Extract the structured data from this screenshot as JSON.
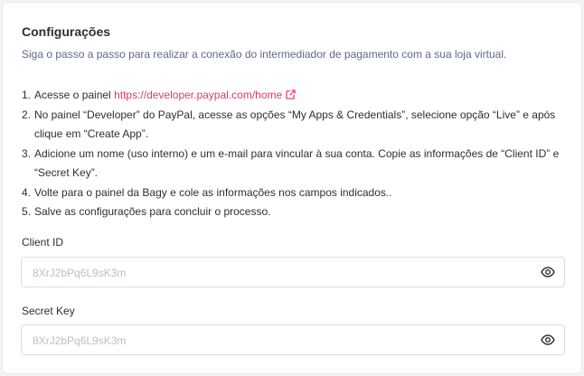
{
  "header": {
    "title": "Configurações",
    "subtitle": "Siga o passo a passo para realizar a conexão do intermediador de pagamento com a sua loja virtual."
  },
  "steps": [
    {
      "num": "1.",
      "text": "Acesse o painel ",
      "link": "https://developer.paypal.com/home"
    },
    {
      "num": "2.",
      "text": "No painel “Developer” do PayPal, acesse as opções “My Apps & Credentials”, selecione opção “Live” e após clique em “Create App”."
    },
    {
      "num": "3.",
      "text": "Adicione um nome (uso interno) e um e-mail para vincular à sua conta. Copie as informações de “Client ID” e “Secret Key”."
    },
    {
      "num": "4.",
      "text": "Volte para o painel da Bagy e cole as informações nos campos indicados.."
    },
    {
      "num": "5.",
      "text": "Salve as configurações para concluir o processo."
    }
  ],
  "fields": {
    "client_id": {
      "label": "Client ID",
      "placeholder": "8XrJ2bPq6L9sK3m",
      "value": ""
    },
    "secret_key": {
      "label": "Secret Key",
      "placeholder": "8XrJ2bPq6L9sK3m",
      "value": ""
    }
  },
  "icons": {
    "external_link": "external-link-icon",
    "eye": "eye-icon"
  },
  "colors": {
    "link": "#e8336b",
    "subtitle": "#5a6b86",
    "text": "#2b2f36",
    "placeholder": "#b8bfca"
  }
}
